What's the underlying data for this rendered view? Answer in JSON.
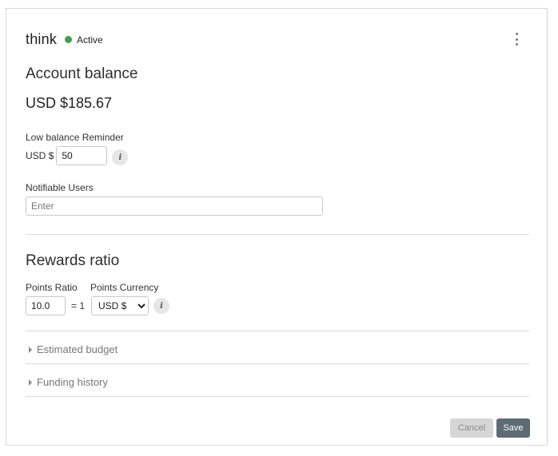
{
  "header": {
    "brand": "think",
    "status": "Active"
  },
  "account": {
    "title": "Account balance",
    "balance": "USD $185.67",
    "low_balance_label": "Low balance Reminder",
    "currency_prefix": "USD $",
    "low_balance_value": "50",
    "notifiable_label": "Notifiable Users",
    "notifiable_placeholder": "Enter"
  },
  "rewards": {
    "title": "Rewards ratio",
    "points_ratio_label": "Points Ratio",
    "points_currency_label": "Points Currency",
    "points_ratio_value": "10.0",
    "equals_text": "= 1",
    "currency_options": [
      "USD $"
    ],
    "currency_selected": "USD $"
  },
  "sections": {
    "estimated_budget": "Estimated budget",
    "funding_history": "Funding history"
  },
  "actions": {
    "cancel": "Cancel",
    "save": "Save"
  },
  "colors": {
    "status_active": "#3da24a",
    "save_button": "#5d6b74",
    "cancel_button": "#d6d6d6"
  },
  "icons": {
    "menu": "kebab-menu-icon",
    "info": "info-icon",
    "expand": "caret-right-icon"
  }
}
